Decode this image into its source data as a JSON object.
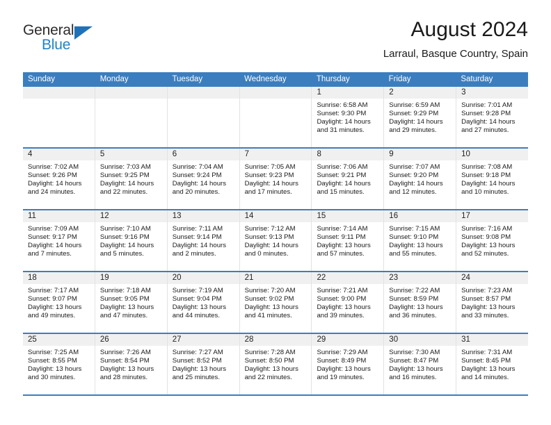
{
  "brand": {
    "name_top": "General",
    "name_bottom": "Blue",
    "triangle_color": "#1f72b8",
    "blue_color": "#2083c8"
  },
  "header": {
    "title": "August 2024",
    "subtitle": "Larraul, Basque Country, Spain"
  },
  "theme": {
    "header_blue": "#3b7ebf",
    "daynum_bg": "#f0f0f0",
    "cell_border": "#e2e2e2"
  },
  "weekdays": [
    "Sunday",
    "Monday",
    "Tuesday",
    "Wednesday",
    "Thursday",
    "Friday",
    "Saturday"
  ],
  "weeks": [
    [
      {
        "day": "",
        "empty": true
      },
      {
        "day": "",
        "empty": true
      },
      {
        "day": "",
        "empty": true
      },
      {
        "day": "",
        "empty": true
      },
      {
        "day": "1",
        "sunrise": "Sunrise: 6:58 AM",
        "sunset": "Sunset: 9:30 PM",
        "daylight_1": "Daylight: 14 hours",
        "daylight_2": "and 31 minutes."
      },
      {
        "day": "2",
        "sunrise": "Sunrise: 6:59 AM",
        "sunset": "Sunset: 9:29 PM",
        "daylight_1": "Daylight: 14 hours",
        "daylight_2": "and 29 minutes."
      },
      {
        "day": "3",
        "sunrise": "Sunrise: 7:01 AM",
        "sunset": "Sunset: 9:28 PM",
        "daylight_1": "Daylight: 14 hours",
        "daylight_2": "and 27 minutes."
      }
    ],
    [
      {
        "day": "4",
        "sunrise": "Sunrise: 7:02 AM",
        "sunset": "Sunset: 9:26 PM",
        "daylight_1": "Daylight: 14 hours",
        "daylight_2": "and 24 minutes."
      },
      {
        "day": "5",
        "sunrise": "Sunrise: 7:03 AM",
        "sunset": "Sunset: 9:25 PM",
        "daylight_1": "Daylight: 14 hours",
        "daylight_2": "and 22 minutes."
      },
      {
        "day": "6",
        "sunrise": "Sunrise: 7:04 AM",
        "sunset": "Sunset: 9:24 PM",
        "daylight_1": "Daylight: 14 hours",
        "daylight_2": "and 20 minutes."
      },
      {
        "day": "7",
        "sunrise": "Sunrise: 7:05 AM",
        "sunset": "Sunset: 9:23 PM",
        "daylight_1": "Daylight: 14 hours",
        "daylight_2": "and 17 minutes."
      },
      {
        "day": "8",
        "sunrise": "Sunrise: 7:06 AM",
        "sunset": "Sunset: 9:21 PM",
        "daylight_1": "Daylight: 14 hours",
        "daylight_2": "and 15 minutes."
      },
      {
        "day": "9",
        "sunrise": "Sunrise: 7:07 AM",
        "sunset": "Sunset: 9:20 PM",
        "daylight_1": "Daylight: 14 hours",
        "daylight_2": "and 12 minutes."
      },
      {
        "day": "10",
        "sunrise": "Sunrise: 7:08 AM",
        "sunset": "Sunset: 9:18 PM",
        "daylight_1": "Daylight: 14 hours",
        "daylight_2": "and 10 minutes."
      }
    ],
    [
      {
        "day": "11",
        "sunrise": "Sunrise: 7:09 AM",
        "sunset": "Sunset: 9:17 PM",
        "daylight_1": "Daylight: 14 hours",
        "daylight_2": "and 7 minutes."
      },
      {
        "day": "12",
        "sunrise": "Sunrise: 7:10 AM",
        "sunset": "Sunset: 9:16 PM",
        "daylight_1": "Daylight: 14 hours",
        "daylight_2": "and 5 minutes."
      },
      {
        "day": "13",
        "sunrise": "Sunrise: 7:11 AM",
        "sunset": "Sunset: 9:14 PM",
        "daylight_1": "Daylight: 14 hours",
        "daylight_2": "and 2 minutes."
      },
      {
        "day": "14",
        "sunrise": "Sunrise: 7:12 AM",
        "sunset": "Sunset: 9:13 PM",
        "daylight_1": "Daylight: 14 hours",
        "daylight_2": "and 0 minutes."
      },
      {
        "day": "15",
        "sunrise": "Sunrise: 7:14 AM",
        "sunset": "Sunset: 9:11 PM",
        "daylight_1": "Daylight: 13 hours",
        "daylight_2": "and 57 minutes."
      },
      {
        "day": "16",
        "sunrise": "Sunrise: 7:15 AM",
        "sunset": "Sunset: 9:10 PM",
        "daylight_1": "Daylight: 13 hours",
        "daylight_2": "and 55 minutes."
      },
      {
        "day": "17",
        "sunrise": "Sunrise: 7:16 AM",
        "sunset": "Sunset: 9:08 PM",
        "daylight_1": "Daylight: 13 hours",
        "daylight_2": "and 52 minutes."
      }
    ],
    [
      {
        "day": "18",
        "sunrise": "Sunrise: 7:17 AM",
        "sunset": "Sunset: 9:07 PM",
        "daylight_1": "Daylight: 13 hours",
        "daylight_2": "and 49 minutes."
      },
      {
        "day": "19",
        "sunrise": "Sunrise: 7:18 AM",
        "sunset": "Sunset: 9:05 PM",
        "daylight_1": "Daylight: 13 hours",
        "daylight_2": "and 47 minutes."
      },
      {
        "day": "20",
        "sunrise": "Sunrise: 7:19 AM",
        "sunset": "Sunset: 9:04 PM",
        "daylight_1": "Daylight: 13 hours",
        "daylight_2": "and 44 minutes."
      },
      {
        "day": "21",
        "sunrise": "Sunrise: 7:20 AM",
        "sunset": "Sunset: 9:02 PM",
        "daylight_1": "Daylight: 13 hours",
        "daylight_2": "and 41 minutes."
      },
      {
        "day": "22",
        "sunrise": "Sunrise: 7:21 AM",
        "sunset": "Sunset: 9:00 PM",
        "daylight_1": "Daylight: 13 hours",
        "daylight_2": "and 39 minutes."
      },
      {
        "day": "23",
        "sunrise": "Sunrise: 7:22 AM",
        "sunset": "Sunset: 8:59 PM",
        "daylight_1": "Daylight: 13 hours",
        "daylight_2": "and 36 minutes."
      },
      {
        "day": "24",
        "sunrise": "Sunrise: 7:23 AM",
        "sunset": "Sunset: 8:57 PM",
        "daylight_1": "Daylight: 13 hours",
        "daylight_2": "and 33 minutes."
      }
    ],
    [
      {
        "day": "25",
        "sunrise": "Sunrise: 7:25 AM",
        "sunset": "Sunset: 8:55 PM",
        "daylight_1": "Daylight: 13 hours",
        "daylight_2": "and 30 minutes."
      },
      {
        "day": "26",
        "sunrise": "Sunrise: 7:26 AM",
        "sunset": "Sunset: 8:54 PM",
        "daylight_1": "Daylight: 13 hours",
        "daylight_2": "and 28 minutes."
      },
      {
        "day": "27",
        "sunrise": "Sunrise: 7:27 AM",
        "sunset": "Sunset: 8:52 PM",
        "daylight_1": "Daylight: 13 hours",
        "daylight_2": "and 25 minutes."
      },
      {
        "day": "28",
        "sunrise": "Sunrise: 7:28 AM",
        "sunset": "Sunset: 8:50 PM",
        "daylight_1": "Daylight: 13 hours",
        "daylight_2": "and 22 minutes."
      },
      {
        "day": "29",
        "sunrise": "Sunrise: 7:29 AM",
        "sunset": "Sunset: 8:49 PM",
        "daylight_1": "Daylight: 13 hours",
        "daylight_2": "and 19 minutes."
      },
      {
        "day": "30",
        "sunrise": "Sunrise: 7:30 AM",
        "sunset": "Sunset: 8:47 PM",
        "daylight_1": "Daylight: 13 hours",
        "daylight_2": "and 16 minutes."
      },
      {
        "day": "31",
        "sunrise": "Sunrise: 7:31 AM",
        "sunset": "Sunset: 8:45 PM",
        "daylight_1": "Daylight: 13 hours",
        "daylight_2": "and 14 minutes."
      }
    ]
  ]
}
